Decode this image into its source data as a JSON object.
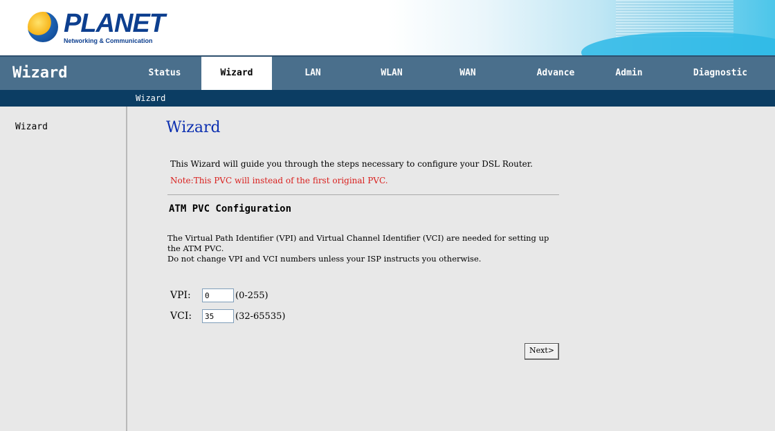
{
  "brand": {
    "logo_text": "PLANET",
    "logo_subtitle": "Networking & Communication"
  },
  "nav": {
    "title": "Wizard",
    "tabs": [
      {
        "label": "Status",
        "active": false
      },
      {
        "label": "Wizard",
        "active": true
      },
      {
        "label": "LAN",
        "active": false
      },
      {
        "label": "WLAN",
        "active": false
      },
      {
        "label": "WAN",
        "active": false
      },
      {
        "label": "Advance",
        "active": false
      },
      {
        "label": "Admin",
        "active": false
      },
      {
        "label": "Diagnostic",
        "active": false
      }
    ],
    "subnav": "Wizard"
  },
  "sidebar": {
    "items": [
      "Wizard"
    ]
  },
  "main": {
    "title": "Wizard",
    "intro": "This Wizard will guide you through the steps necessary to configure your DSL Router.",
    "note": "Note:This PVC will instead of the first original PVC.",
    "section_title": "ATM PVC Configuration",
    "desc_line1": "The Virtual Path Identifier (VPI) and Virtual Channel Identifier (VCI) are needed for setting up the ATM PVC.",
    "desc_line2": "Do not change VPI and VCI numbers unless your ISP instructs you otherwise.",
    "vpi": {
      "label": "VPI:",
      "value": "0",
      "range": "(0-255)"
    },
    "vci": {
      "label": "VCI:",
      "value": "35",
      "range": "(32-65535)"
    },
    "next_label": "Next>"
  },
  "colors": {
    "nav_bg": "#4a6f8c",
    "subnav_bg": "#0b3d63",
    "title_blue": "#0c2fb0",
    "note_red": "#d9201e",
    "page_bg": "#e8e8e8"
  }
}
